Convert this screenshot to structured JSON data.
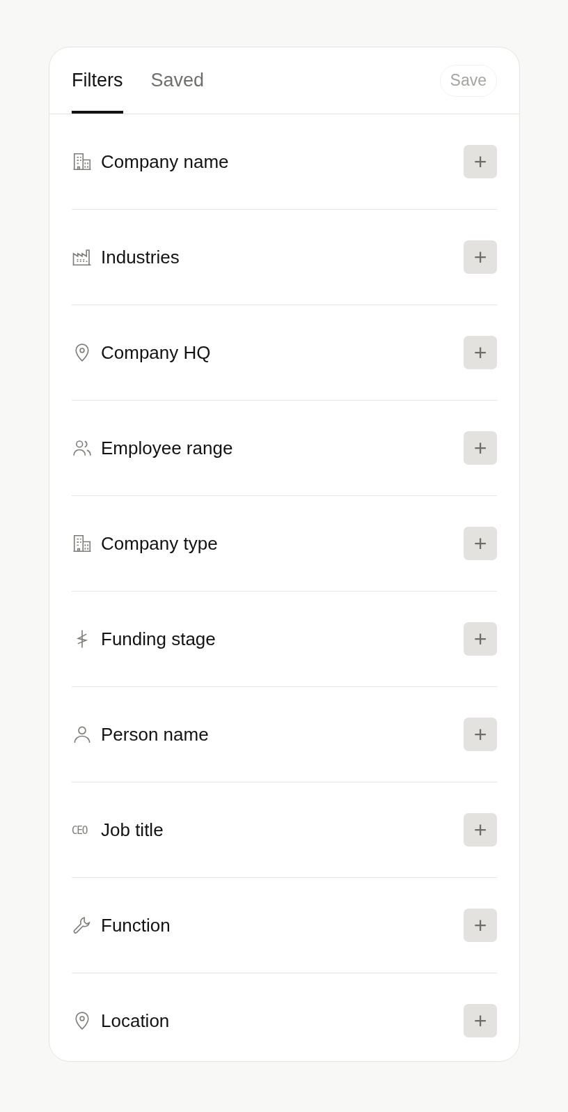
{
  "tabs": [
    {
      "label": "Filters",
      "selected": true
    },
    {
      "label": "Saved",
      "selected": false
    }
  ],
  "save_button": {
    "label": "Save",
    "disabled": true
  },
  "filters": [
    {
      "label": "Company name",
      "kind": "building",
      "add": "+"
    },
    {
      "label": "Industries",
      "kind": "factory",
      "add": "+"
    },
    {
      "label": "Company HQ",
      "kind": "pin",
      "add": "+"
    },
    {
      "label": "Employee range",
      "kind": "people",
      "add": "+"
    },
    {
      "label": "Company type",
      "kind": "building",
      "add": "+"
    },
    {
      "label": "Funding stage",
      "kind": "dollar",
      "add": "+"
    },
    {
      "label": "Person name",
      "kind": "person",
      "add": "+"
    },
    {
      "label": "Job title",
      "kind": "text",
      "icon_text": "CEO",
      "add": "+"
    },
    {
      "label": "Function",
      "kind": "wrench",
      "add": "+"
    },
    {
      "label": "Location",
      "kind": "pin",
      "add": "+"
    }
  ]
}
